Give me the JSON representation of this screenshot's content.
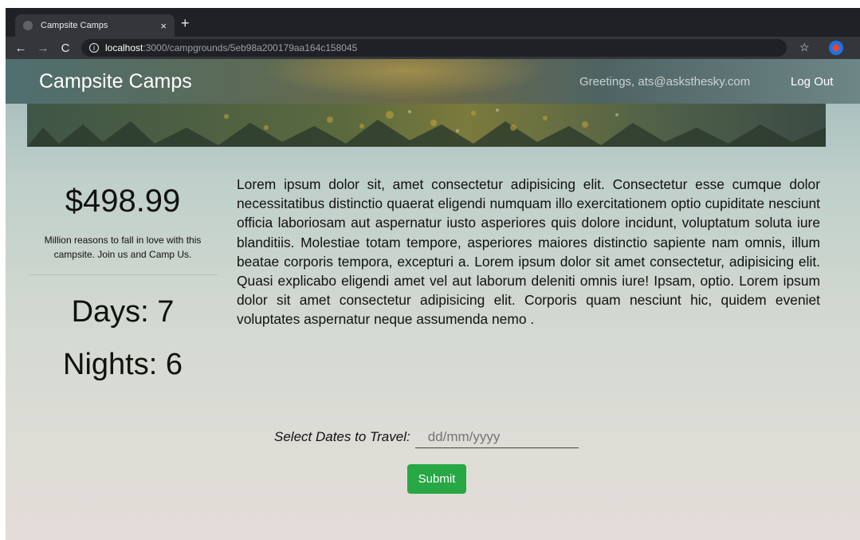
{
  "browser": {
    "tab_title": "Campsite Camps",
    "tab_close": "×",
    "new_tab": "+",
    "url_host": "localhost",
    "url_path": ":3000/campgrounds/5eb98a200179aa164c158045"
  },
  "navbar": {
    "brand": "Campsite Camps",
    "greeting": "Greetings, ats@asksthesky.com",
    "logout": "Log Out"
  },
  "sidebar": {
    "price": "$498.99",
    "tagline": "Million reasons to fall in love with this campsite. Join us and Camp Us.",
    "days": "Days: 7",
    "nights": "Nights: 6"
  },
  "description": "Lorem ipsum dolor sit, amet consectetur adipisicing elit. Consectetur esse cumque dolor necessitatibus distinctio quaerat eligendi numquam illo exercitationem optio cupiditate nesciunt officia laboriosam aut aspernatur iusto asperiores quis dolore incidunt, voluptatum soluta iure blanditiis. Molestiae totam tempore, asperiores maiores distinctio sapiente nam omnis, illum beatae corporis tempora, excepturi a. Lorem ipsum dolor sit amet consectetur, adipisicing elit. Quasi explicabo eligendi amet vel aut laborum deleniti omnis iure! Ipsam, optio. Lorem ipsum dolor sit amet consectetur adipisicing elit. Corporis quam nesciunt hic, quidem eveniet voluptates aspernatur neque assumenda nemo .",
  "booking": {
    "label": "Select Dates to Travel:",
    "placeholder": "dd/mm/yyyy",
    "submit": "Submit"
  },
  "colors": {
    "submit_bg": "#28a745",
    "chrome_dark": "#202124"
  }
}
